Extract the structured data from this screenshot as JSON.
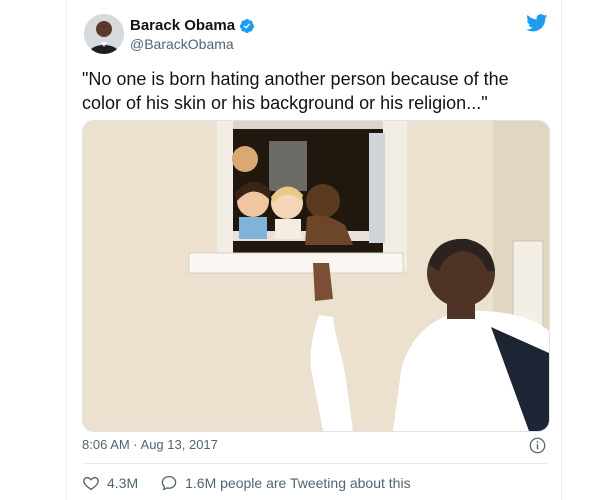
{
  "tweet": {
    "author_name": "Barack Obama",
    "handle": "@BarackObama",
    "verified_icon": "verified-badge-icon",
    "text": "\"No one is born hating another person because of the color of his skin or his background or his religion...\"",
    "timestamp": "8:06 AM · Aug 13, 2017",
    "likes": "4.3M",
    "retweet_text": "1.6M people are Tweeting about this"
  },
  "colors": {
    "twitter_blue": "#1d9bf0",
    "text_primary": "#0f1419",
    "text_secondary": "#536471"
  }
}
